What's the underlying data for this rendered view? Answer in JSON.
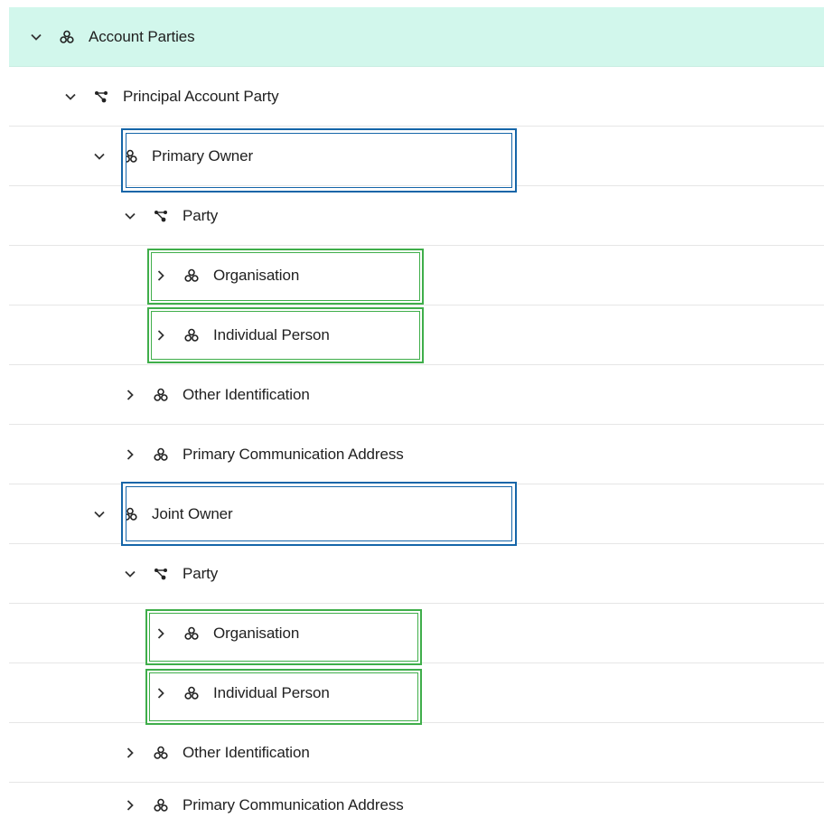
{
  "colors": {
    "selected_row_bg": "#d2f7ec",
    "blue_highlight": "#1565a8",
    "green_highlight": "#3fae4a"
  },
  "tree": {
    "rows": [
      {
        "label": "Account Parties",
        "expanded": true,
        "icon": "group-icon",
        "selected": true
      },
      {
        "label": "Principal Account Party",
        "expanded": true,
        "icon": "relationship-icon"
      },
      {
        "label": "Primary Owner",
        "expanded": true,
        "icon": "group-icon"
      },
      {
        "label": "Party",
        "expanded": true,
        "icon": "relationship-icon"
      },
      {
        "label": "Organisation",
        "expanded": false,
        "icon": "group-icon"
      },
      {
        "label": "Individual Person",
        "expanded": false,
        "icon": "group-icon"
      },
      {
        "label": "Other Identification",
        "expanded": false,
        "icon": "group-icon"
      },
      {
        "label": "Primary Communication Address",
        "expanded": false,
        "icon": "group-icon"
      },
      {
        "label": "Joint Owner",
        "expanded": true,
        "icon": "group-icon"
      },
      {
        "label": "Party",
        "expanded": true,
        "icon": "relationship-icon"
      },
      {
        "label": "Organisation",
        "expanded": false,
        "icon": "group-icon"
      },
      {
        "label": "Individual Person",
        "expanded": false,
        "icon": "group-icon"
      },
      {
        "label": "Other Identification",
        "expanded": false,
        "icon": "group-icon"
      },
      {
        "label": "Primary Communication Address",
        "expanded": false,
        "icon": "group-icon"
      }
    ]
  }
}
